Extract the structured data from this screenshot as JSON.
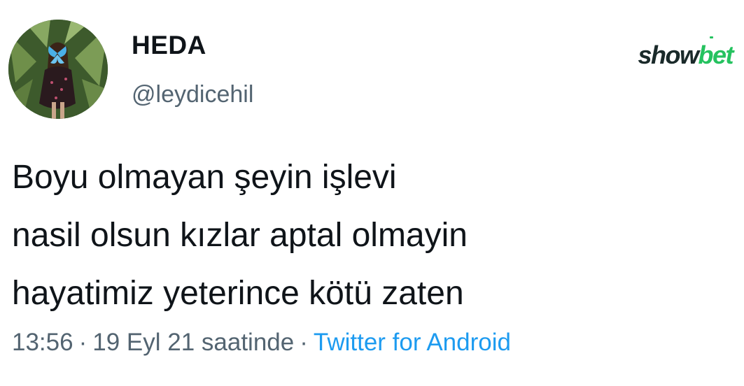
{
  "author": {
    "display_name": "HEDA",
    "handle": "@leydicehil",
    "avatar_icon": "profile-photo-avatar"
  },
  "brand": {
    "logo_part1": "show",
    "logo_part2": "bet",
    "logo_color_dark": "#1a2a2a",
    "logo_color_accent": "#25c25f"
  },
  "tweet": {
    "lines": [
      "Boyu olmayan şeyin işlevi",
      "nasil olsun kızlar aptal olmayin",
      "hayatimiz yeterince kötü zaten"
    ],
    "time": "13:56",
    "date": "19 Eyl 21 saatinde",
    "separator": "·",
    "source": "Twitter for Android"
  },
  "colors": {
    "text_primary": "#0f1419",
    "text_secondary": "#536471",
    "link": "#1d9bf0"
  }
}
